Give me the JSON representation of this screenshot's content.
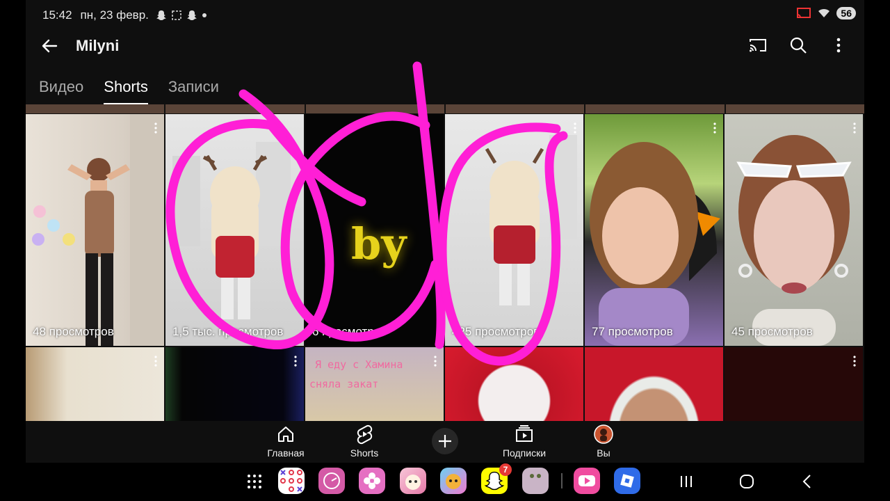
{
  "status": {
    "time": "15:42",
    "date": "пн, 23 февр.",
    "battery": "56"
  },
  "header": {
    "title": "Milyni"
  },
  "tabs": [
    {
      "label": "Видео",
      "active": false
    },
    {
      "label": "Shorts",
      "active": true
    },
    {
      "label": "Записи",
      "active": false
    }
  ],
  "shorts": [
    {
      "views": "48 просмотров"
    },
    {
      "views": "1,5 тыс. просмотров"
    },
    {
      "views": "6 просмотров"
    },
    {
      "views": "425 просмотров"
    },
    {
      "views": "77 просмотров"
    },
    {
      "views": "45 просмотров"
    }
  ],
  "row2_caption": {
    "line1": "Я еду с Хамина",
    "line2": "сняла закат"
  },
  "overlay_text": "by",
  "nav": [
    {
      "label": "Главная"
    },
    {
      "label": "Shorts"
    },
    {
      "label": "Подписки"
    },
    {
      "label": "Вы"
    }
  ],
  "dock": {
    "snapchat_badge": "7"
  },
  "colors": {
    "accent_draw": "#ff1fd6",
    "background": "#0f0f0f"
  }
}
